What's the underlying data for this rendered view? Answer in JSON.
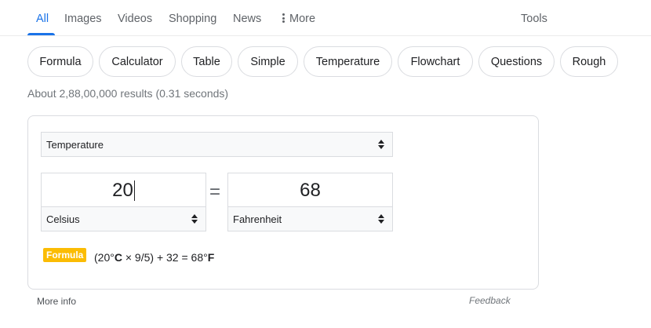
{
  "tabs": [
    {
      "label": "All",
      "active": true
    },
    {
      "label": "Images"
    },
    {
      "label": "Videos"
    },
    {
      "label": "Shopping"
    },
    {
      "label": "News"
    },
    {
      "label": "More"
    }
  ],
  "tools_label": "Tools",
  "chips": [
    "Formula",
    "Calculator",
    "Table",
    "Simple",
    "Temperature",
    "Flowchart",
    "Questions",
    "Rough"
  ],
  "result_stats": "About 2,88,00,000 results (0.31 seconds)",
  "converter": {
    "measure": "Temperature",
    "from_value": "20",
    "from_unit": "Celsius",
    "equals": "=",
    "to_value": "68",
    "to_unit": "Fahrenheit",
    "formula_label": "Formula",
    "formula": {
      "open": "(20°",
      "unit_from": "C",
      "middle": " × 9/5) + 32 = 68°",
      "unit_to": "F"
    }
  },
  "footer": {
    "more_info": "More info",
    "feedback": "Feedback"
  },
  "colors": {
    "accent": "#1a73e8",
    "formula_badge": "#fbbc04"
  }
}
